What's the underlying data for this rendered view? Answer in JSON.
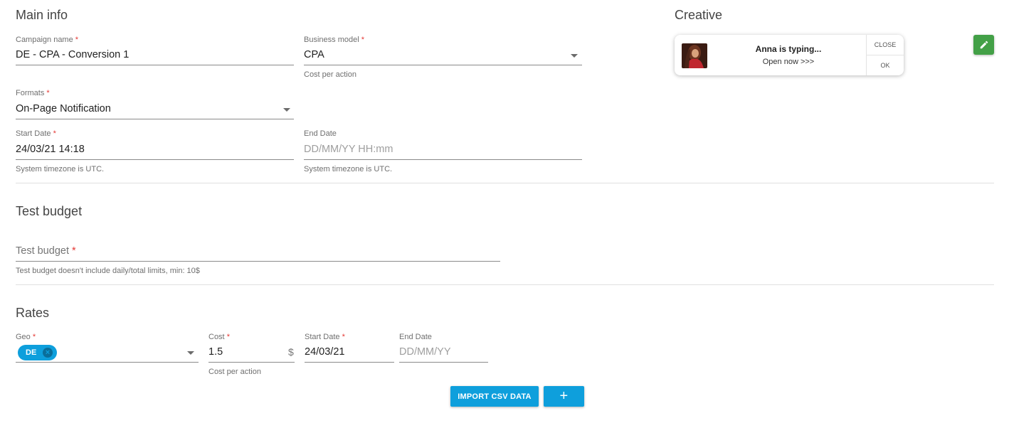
{
  "main_info": {
    "title": "Main info",
    "campaign_name": {
      "label": "Campaign name",
      "value": "DE - CPA - Conversion 1"
    },
    "business_model": {
      "label": "Business model",
      "value": "CPA",
      "hint": "Cost per action"
    },
    "formats": {
      "label": "Formats",
      "value": "On-Page Notification"
    },
    "start_date": {
      "label": "Start Date",
      "value": "24/03/21 14:18",
      "hint": "System timezone is UTC."
    },
    "end_date": {
      "label": "End Date",
      "placeholder": "DD/MM/YY HH:mm",
      "hint": "System timezone is UTC."
    }
  },
  "creative": {
    "title": "Creative",
    "notification": {
      "title": "Anna is typing...",
      "subtitle": "Open now >>>",
      "close_label": "CLOSE",
      "ok_label": "OK"
    }
  },
  "test_budget": {
    "title": "Test budget",
    "field": {
      "placeholder": "Test budget",
      "hint": "Test budget doesn't include daily/total limits, min: 10$"
    }
  },
  "rates": {
    "title": "Rates",
    "geo": {
      "label": "Geo",
      "chip": "DE"
    },
    "cost": {
      "label": "Cost",
      "value": "1.5",
      "suffix": "$",
      "hint": "Cost per action"
    },
    "start_date": {
      "label": "Start Date",
      "value": "24/03/21"
    },
    "end_date": {
      "label": "End Date",
      "placeholder": "DD/MM/YY"
    },
    "import_button": "IMPORT CSV DATA",
    "add_button": "+"
  },
  "required_mark": "*",
  "colors": {
    "accent": "#0e9fdc",
    "edit_button": "#43a047",
    "required": "#e53935"
  },
  "icons": [
    "caret-down-icon",
    "chip-remove-icon",
    "pencil-icon",
    "plus-icon"
  ]
}
